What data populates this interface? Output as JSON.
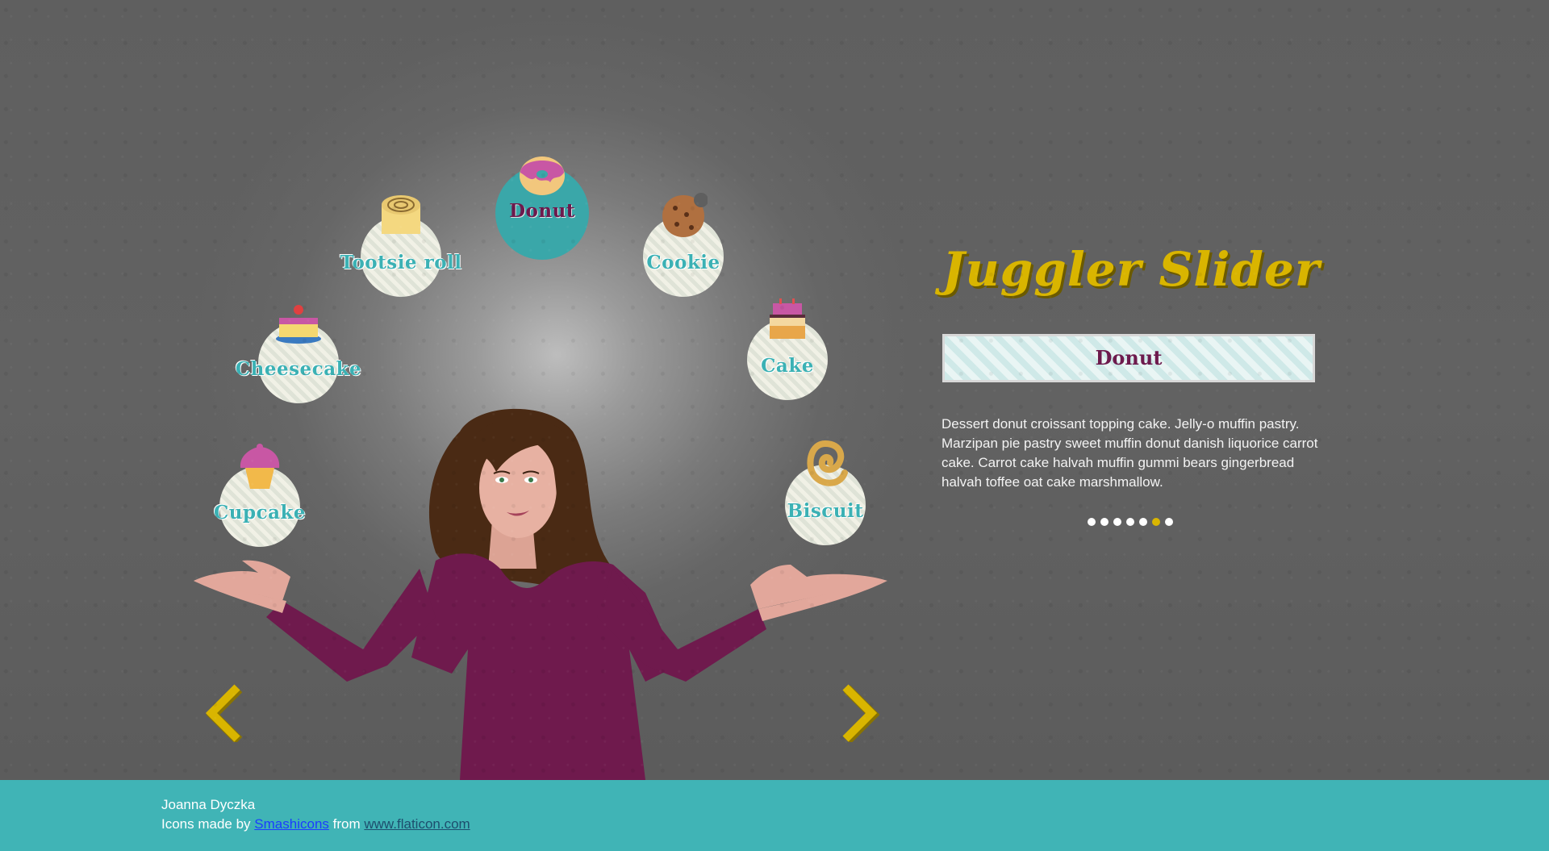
{
  "title": "Juggler Slider",
  "selected_name": "Donut",
  "description": "Dessert donut croissant topping cake. Jelly-o muffin pastry. Marzipan pie pastry sweet muffin donut danish liquorice carrot cake. Carrot cake halvah muffin gummi bears gingerbread halvah toffee oat cake marshmallow.",
  "items": [
    {
      "label": "Donut",
      "icon": "donut-icon",
      "active": true
    },
    {
      "label": "Cookie",
      "icon": "cookie-icon"
    },
    {
      "label": "Cake",
      "icon": "cake-icon"
    },
    {
      "label": "Biscuit",
      "icon": "biscuit-icon"
    },
    {
      "label": "Cupcake",
      "icon": "cupcake-icon"
    },
    {
      "label": "Cheesecake",
      "icon": "cheesecake-icon"
    },
    {
      "label": "Tootsie roll",
      "icon": "tootsie-roll-icon"
    }
  ],
  "pagination": {
    "count": 7,
    "active_index": 5
  },
  "footer": {
    "author": "Joanna Dyczka",
    "credit_prefix": "Icons made by",
    "credit_link": "Smashicons",
    "credit_middle": "from",
    "credit_site": "www.flaticon.com"
  },
  "colors": {
    "accent_yellow": "#d9b500",
    "teal": "#3aa7a9",
    "plum": "#6d1a4d",
    "footer_bg": "#40b4b6"
  }
}
